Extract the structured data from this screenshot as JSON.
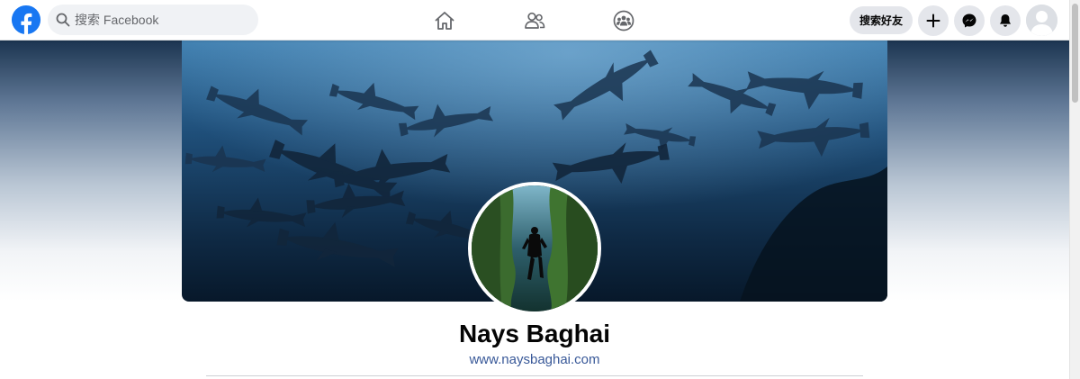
{
  "app": {
    "brand": "Facebook",
    "brand_color": "#1877f2"
  },
  "topbar": {
    "search": {
      "placeholder": "搜索 Facebook",
      "value": ""
    },
    "tabs": [
      {
        "icon": "home-icon"
      },
      {
        "icon": "friends-icon"
      },
      {
        "icon": "groups-icon"
      }
    ],
    "find_friends_label": "搜索好友",
    "actions": [
      {
        "icon": "plus-icon"
      },
      {
        "icon": "messenger-icon"
      },
      {
        "icon": "bell-icon"
      },
      {
        "icon": "account-avatar"
      }
    ]
  },
  "profile": {
    "name": "Nays Baghai",
    "website": "www.naysbaghai.com",
    "link_color": "#385898"
  }
}
